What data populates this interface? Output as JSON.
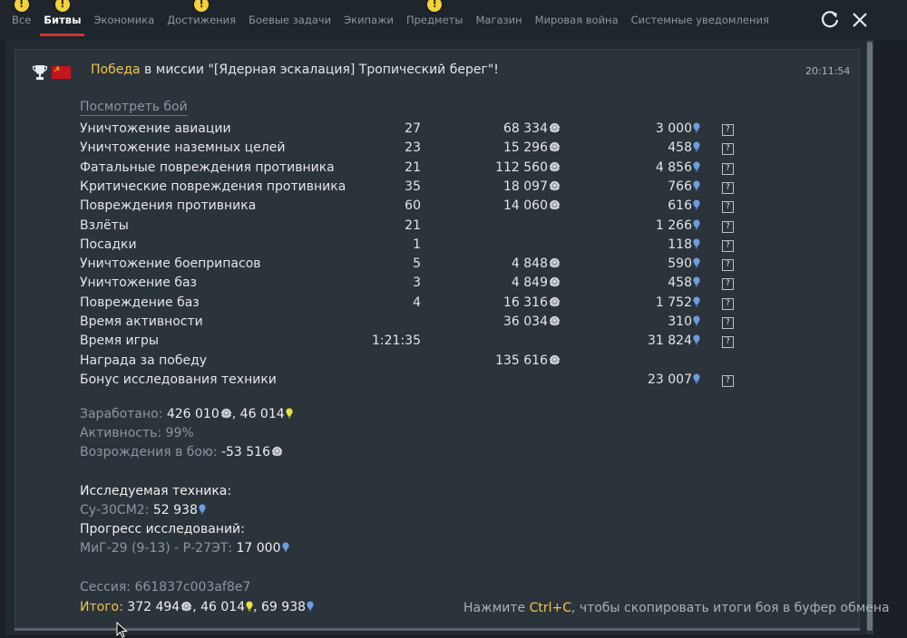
{
  "tabs": [
    {
      "label": "Все",
      "alert": true
    },
    {
      "label": "Битвы",
      "alert": true,
      "active": true
    },
    {
      "label": "Экономика",
      "alert": false
    },
    {
      "label": "Достижения",
      "alert": true
    },
    {
      "label": "Боевые задачи",
      "alert": false
    },
    {
      "label": "Экипажи",
      "alert": false
    },
    {
      "label": "Предметы",
      "alert": true
    },
    {
      "label": "Магазин",
      "alert": false
    },
    {
      "label": "Мировая война",
      "alert": false
    },
    {
      "label": "Системные уведомления",
      "alert": false
    }
  ],
  "alert_glyph": "!",
  "header": {
    "victory": "Победа",
    "mission": " в миссии \"[Ядерная эскалация] Тропический берег\"!",
    "time": "20:11:54"
  },
  "view_battle": "Посмотреть бой",
  "help_glyph": "?",
  "rows": [
    {
      "label": "Уничтожение авиации",
      "count": "27",
      "silver": "68 334",
      "rp": "3 000",
      "help": true
    },
    {
      "label": "Уничтожение наземных целей",
      "count": "23",
      "silver": "15 296",
      "rp": "458",
      "help": true
    },
    {
      "label": "Фатальные повреждения противника",
      "count": "21",
      "silver": "112 560",
      "rp": "4 856",
      "help": true
    },
    {
      "label": "Критические повреждения противника",
      "count": "35",
      "silver": "18 097",
      "rp": "766",
      "help": true
    },
    {
      "label": "Повреждения противника",
      "count": "60",
      "silver": "14 060",
      "rp": "616",
      "help": true
    },
    {
      "label": "Взлёты",
      "count": "21",
      "silver": "",
      "rp": "1 266",
      "help": true
    },
    {
      "label": "Посадки",
      "count": "1",
      "silver": "",
      "rp": "118",
      "help": true
    },
    {
      "label": "Уничтожение боеприпасов",
      "count": "5",
      "silver": "4 848",
      "rp": "590",
      "help": true
    },
    {
      "label": "Уничтожение баз",
      "count": "3",
      "silver": "4 849",
      "rp": "458",
      "help": true
    },
    {
      "label": "Повреждение баз",
      "count": "4",
      "silver": "16 316",
      "rp": "1 752",
      "help": true
    },
    {
      "label": "Время активности",
      "count": "",
      "silver": "36 034",
      "rp": "310",
      "help": true
    },
    {
      "label": "Время игры",
      "count": "1:21:35",
      "silver": "",
      "rp": "31 824",
      "help": true
    },
    {
      "label": "Награда за победу",
      "count": "",
      "silver": "135 616",
      "rp": "",
      "help": false
    },
    {
      "label": "Бонус исследования техники",
      "count": "",
      "silver": "",
      "rp": "23 007",
      "help": true
    }
  ],
  "summary": {
    "earned_label": "Заработано:",
    "earned_silver": "426 010",
    "sep": ",",
    "earned_gold": "46 014",
    "activity_label": "Активность:",
    "activity_value": "99%",
    "respawn_label": "Возрождения в бою:",
    "respawn_value": "-53 516"
  },
  "research": {
    "title": "Исследуемая техника:",
    "vehicle": "Су-30СМ2:",
    "vehicle_rp": "52 938",
    "progress_title": "Прогресс исследований:",
    "module": "МиГ-29 (9-13) - Р-27ЭТ:",
    "module_rp": "17 000"
  },
  "session": {
    "label": "Сессия:",
    "id": "661837c003af8e7"
  },
  "total": {
    "label": "Итого:",
    "silver": "372 494",
    "sep1": ",",
    "gold": "46 014",
    "sep2": ",",
    "rp": "69 938"
  },
  "copy_hint": {
    "pre": "Нажмите ",
    "key": "Ctrl+C",
    "post": ", чтобы скопировать итоги боя в буфер обмена"
  },
  "colors": {
    "accent_gold": "#f0c64e",
    "tab_underline": "#c93a2c",
    "rp_blue": "#6f9be0",
    "gold_bulb": "#e8e23a",
    "alert_yellow": "#f2d23a"
  },
  "icons": [
    "trophy-icon",
    "ussr-flag-icon",
    "refresh-icon",
    "close-icon",
    "silver-lions-icon",
    "research-points-icon",
    "golden-eagles-icon",
    "help-icon",
    "mouse-cursor-icon"
  ]
}
